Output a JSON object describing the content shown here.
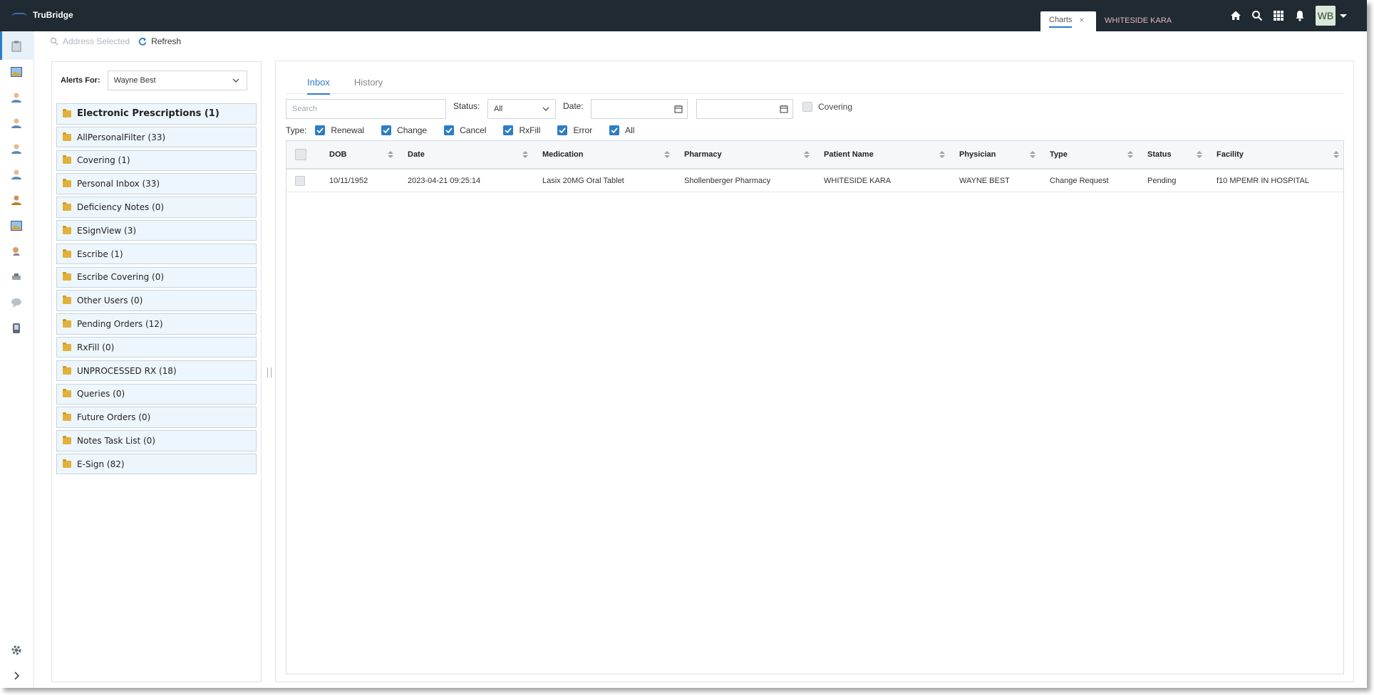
{
  "app": {
    "brand": "TruBridge"
  },
  "header_tabs": {
    "charts_label": "Charts",
    "patient_label": "WHITESIDE KARA"
  },
  "user": {
    "initials": "WB"
  },
  "toolbar": {
    "address_selected": "Address Selected",
    "refresh": "Refresh"
  },
  "alerts": {
    "label": "Alerts For:",
    "selected_user": "Wayne Best"
  },
  "folders": [
    {
      "label": "Electronic Prescriptions (1)"
    },
    {
      "label": "AllPersonalFilter (33)"
    },
    {
      "label": "Covering (1)"
    },
    {
      "label": "Personal Inbox (33)"
    },
    {
      "label": "Deficiency Notes (0)"
    },
    {
      "label": "ESignView (3)"
    },
    {
      "label": "Escribe (1)"
    },
    {
      "label": "Escribe Covering (0)"
    },
    {
      "label": "Other Users (0)"
    },
    {
      "label": "Pending Orders (12)"
    },
    {
      "label": "RxFill (0)"
    },
    {
      "label": "UNPROCESSED RX (18)"
    },
    {
      "label": "Queries (0)"
    },
    {
      "label": "Future Orders (0)"
    },
    {
      "label": "Notes Task List (0)"
    },
    {
      "label": "E-Sign (82)"
    }
  ],
  "tabs": [
    {
      "label": "Inbox"
    },
    {
      "label": "History"
    }
  ],
  "filters": {
    "search_placeholder": "Search",
    "status_label": "Status:",
    "status_value": "All",
    "date_label": "Date:",
    "covering_label": "Covering"
  },
  "types": {
    "label": "Type:",
    "options": [
      {
        "label": "Renewal"
      },
      {
        "label": "Change"
      },
      {
        "label": "Cancel"
      },
      {
        "label": "RxFill"
      },
      {
        "label": "Error"
      },
      {
        "label": "All"
      }
    ]
  },
  "table": {
    "columns": [
      "DOB",
      "Date",
      "Medication",
      "Pharmacy",
      "Patient Name",
      "Physician",
      "Type",
      "Status",
      "Facility"
    ],
    "rows": [
      [
        "10/11/1952",
        "2023-04-21 09:25:14",
        "Lasix 20MG Oral Tablet",
        "Shollenberger Pharmacy",
        "WHITESIDE KARA",
        "WAYNE BEST",
        "Change Request",
        "Pending",
        "f10 MPEMR IN HOSPITAL"
      ]
    ]
  },
  "colors": {
    "topbar": "#1f2a32",
    "accent": "#2d7dc6",
    "folder_bg": "#eef6fd",
    "folder_icon": "#e2b13c"
  }
}
